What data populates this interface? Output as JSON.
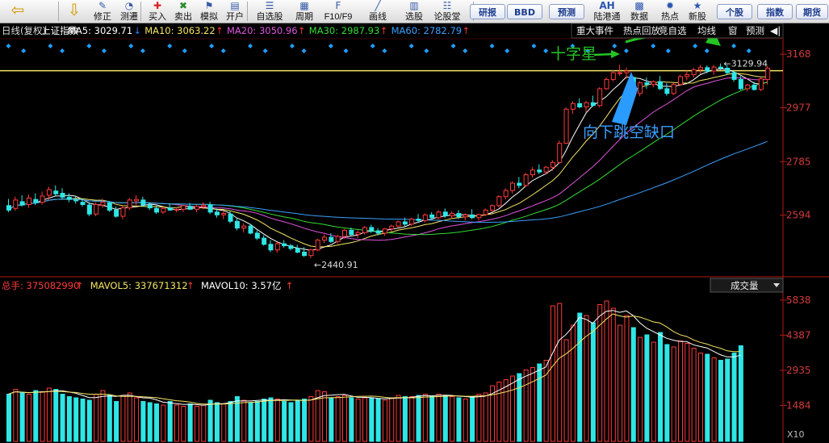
{
  "toolbar": {
    "buttons": [
      {
        "label": "",
        "icon": "left-arrow-icon"
      },
      {
        "label": "",
        "icon": "down-arrow-icon"
      },
      {
        "label": "修正",
        "icon": "edit-icon"
      },
      {
        "label": "测遷",
        "icon": "gauge-icon"
      },
      {
        "label": "买入",
        "icon": "buy-icon"
      },
      {
        "label": "卖出",
        "icon": "sell-icon"
      },
      {
        "label": "模拟",
        "icon": "simulate-icon"
      },
      {
        "label": "开户",
        "icon": "account-icon"
      },
      {
        "label": "自选股",
        "icon": "watchlist-icon"
      },
      {
        "label": "周期",
        "icon": "period-icon"
      },
      {
        "label": "F10/F9",
        "icon": "f10-icon"
      },
      {
        "label": "画线",
        "icon": "draw-line-icon"
      },
      {
        "label": "选股",
        "icon": "stock-picker-icon"
      },
      {
        "label": "论股堂",
        "icon": "forum-icon"
      }
    ],
    "pills": [
      "研报",
      "BBD",
      "预测"
    ],
    "right_buttons": [
      {
        "label": "陆港通",
        "icon": "AH"
      },
      {
        "label": "数据",
        "icon": "data-icon"
      },
      {
        "label": "热点",
        "icon": "hot-icon"
      },
      {
        "label": "新股",
        "icon": "ipo-icon"
      }
    ],
    "tabs": [
      "个股",
      "指数",
      "期货"
    ]
  },
  "kline_header": {
    "period": "日线(复权)",
    "name": "上证指数",
    "ma": [
      {
        "label": "MA5: 3029.71",
        "arrow": "↓",
        "color": "#ffffff",
        "arrow_color": "#2f7cff"
      },
      {
        "label": "MA10: 3063.22",
        "arrow": "↑",
        "color": "#f5e663",
        "arrow_color": "#ff3333"
      },
      {
        "label": "MA20: 3050.96",
        "arrow": "↑",
        "color": "#e055e0",
        "arrow_color": "#ff3333"
      },
      {
        "label": "MA30: 2987.93",
        "arrow": "↑",
        "color": "#33dd33",
        "arrow_color": "#ff3333"
      },
      {
        "label": "MA60: 2782.79",
        "arrow": "↑",
        "color": "#3aa0ff",
        "arrow_color": "#ff3333"
      }
    ],
    "menu": [
      "重大事件",
      "热点回放",
      "竞自选",
      "均线",
      "窗",
      "预测"
    ]
  },
  "vol_header": {
    "total": "总手: 375082990",
    "total_arrow": "↑",
    "mavol5": "MAVOL5: 337671312",
    "mavol5_arrow": "↑",
    "mavol10": "MAVOL10: 3.57亿",
    "mavol10_arrow": "↑",
    "selector": "成交量"
  },
  "annotations": {
    "doji": "十字星",
    "gap": "向下跳空缺口",
    "high_label": "3129.94",
    "low_label": "2440.91"
  },
  "chart_data": {
    "type": "candlestick",
    "title": "上证指数",
    "price_axis": {
      "ticks": [
        3168,
        2977,
        2785,
        2594
      ],
      "range": [
        2380,
        3180
      ]
    },
    "volume_axis": {
      "ticks": [
        5838,
        4387,
        2935,
        1484
      ],
      "unit_label": "X10",
      "range": [
        0,
        6100
      ]
    },
    "reference_line": 3109,
    "candles": [
      {
        "o": 2628,
        "h": 2652,
        "l": 2605,
        "c": 2612
      },
      {
        "o": 2618,
        "h": 2660,
        "l": 2610,
        "c": 2648
      },
      {
        "o": 2642,
        "h": 2665,
        "l": 2625,
        "c": 2630
      },
      {
        "o": 2632,
        "h": 2668,
        "l": 2620,
        "c": 2655
      },
      {
        "o": 2650,
        "h": 2672,
        "l": 2630,
        "c": 2640
      },
      {
        "o": 2640,
        "h": 2678,
        "l": 2632,
        "c": 2662
      },
      {
        "o": 2665,
        "h": 2695,
        "l": 2650,
        "c": 2685
      },
      {
        "o": 2680,
        "h": 2700,
        "l": 2660,
        "c": 2670
      },
      {
        "o": 2672,
        "h": 2690,
        "l": 2650,
        "c": 2658
      },
      {
        "o": 2658,
        "h": 2672,
        "l": 2640,
        "c": 2650
      },
      {
        "o": 2648,
        "h": 2660,
        "l": 2635,
        "c": 2645
      },
      {
        "o": 2640,
        "h": 2652,
        "l": 2625,
        "c": 2632
      },
      {
        "o": 2630,
        "h": 2640,
        "l": 2590,
        "c": 2598
      },
      {
        "o": 2598,
        "h": 2640,
        "l": 2590,
        "c": 2632
      },
      {
        "o": 2630,
        "h": 2652,
        "l": 2620,
        "c": 2640
      },
      {
        "o": 2638,
        "h": 2645,
        "l": 2605,
        "c": 2612
      },
      {
        "o": 2612,
        "h": 2625,
        "l": 2585,
        "c": 2590
      },
      {
        "o": 2590,
        "h": 2628,
        "l": 2580,
        "c": 2620
      },
      {
        "o": 2620,
        "h": 2655,
        "l": 2612,
        "c": 2648
      },
      {
        "o": 2645,
        "h": 2665,
        "l": 2630,
        "c": 2650
      },
      {
        "o": 2648,
        "h": 2660,
        "l": 2625,
        "c": 2630
      },
      {
        "o": 2630,
        "h": 2640,
        "l": 2612,
        "c": 2620
      },
      {
        "o": 2618,
        "h": 2628,
        "l": 2598,
        "c": 2605
      },
      {
        "o": 2605,
        "h": 2625,
        "l": 2598,
        "c": 2618
      },
      {
        "o": 2620,
        "h": 2635,
        "l": 2610,
        "c": 2612
      },
      {
        "o": 2612,
        "h": 2622,
        "l": 2605,
        "c": 2615
      },
      {
        "o": 2615,
        "h": 2630,
        "l": 2605,
        "c": 2628
      },
      {
        "o": 2625,
        "h": 2638,
        "l": 2612,
        "c": 2615
      },
      {
        "o": 2615,
        "h": 2632,
        "l": 2605,
        "c": 2625
      },
      {
        "o": 2625,
        "h": 2640,
        "l": 2615,
        "c": 2630
      },
      {
        "o": 2630,
        "h": 2642,
        "l": 2598,
        "c": 2605
      },
      {
        "o": 2605,
        "h": 2618,
        "l": 2585,
        "c": 2595
      },
      {
        "o": 2595,
        "h": 2608,
        "l": 2580,
        "c": 2600
      },
      {
        "o": 2598,
        "h": 2608,
        "l": 2565,
        "c": 2572
      },
      {
        "o": 2572,
        "h": 2582,
        "l": 2540,
        "c": 2548
      },
      {
        "o": 2548,
        "h": 2565,
        "l": 2532,
        "c": 2555
      },
      {
        "o": 2555,
        "h": 2562,
        "l": 2525,
        "c": 2530
      },
      {
        "o": 2530,
        "h": 2540,
        "l": 2505,
        "c": 2512
      },
      {
        "o": 2512,
        "h": 2522,
        "l": 2485,
        "c": 2490
      },
      {
        "o": 2490,
        "h": 2505,
        "l": 2462,
        "c": 2470
      },
      {
        "o": 2470,
        "h": 2498,
        "l": 2460,
        "c": 2492
      },
      {
        "o": 2492,
        "h": 2505,
        "l": 2478,
        "c": 2485
      },
      {
        "o": 2485,
        "h": 2492,
        "l": 2468,
        "c": 2475
      },
      {
        "o": 2475,
        "h": 2488,
        "l": 2458,
        "c": 2462
      },
      {
        "o": 2462,
        "h": 2480,
        "l": 2445,
        "c": 2450
      },
      {
        "o": 2450,
        "h": 2475,
        "l": 2441,
        "c": 2470
      },
      {
        "o": 2470,
        "h": 2510,
        "l": 2465,
        "c": 2505
      },
      {
        "o": 2505,
        "h": 2525,
        "l": 2495,
        "c": 2515
      },
      {
        "o": 2515,
        "h": 2530,
        "l": 2495,
        "c": 2500
      },
      {
        "o": 2500,
        "h": 2525,
        "l": 2492,
        "c": 2518
      },
      {
        "o": 2518,
        "h": 2545,
        "l": 2510,
        "c": 2540
      },
      {
        "o": 2540,
        "h": 2550,
        "l": 2520,
        "c": 2525
      },
      {
        "o": 2525,
        "h": 2540,
        "l": 2512,
        "c": 2532
      },
      {
        "o": 2532,
        "h": 2555,
        "l": 2525,
        "c": 2550
      },
      {
        "o": 2550,
        "h": 2560,
        "l": 2530,
        "c": 2538
      },
      {
        "o": 2538,
        "h": 2548,
        "l": 2522,
        "c": 2530
      },
      {
        "o": 2530,
        "h": 2548,
        "l": 2520,
        "c": 2545
      },
      {
        "o": 2545,
        "h": 2560,
        "l": 2535,
        "c": 2555
      },
      {
        "o": 2555,
        "h": 2575,
        "l": 2548,
        "c": 2570
      },
      {
        "o": 2570,
        "h": 2585,
        "l": 2555,
        "c": 2562
      },
      {
        "o": 2562,
        "h": 2585,
        "l": 2555,
        "c": 2580
      },
      {
        "o": 2580,
        "h": 2598,
        "l": 2568,
        "c": 2575
      },
      {
        "o": 2575,
        "h": 2600,
        "l": 2568,
        "c": 2595
      },
      {
        "o": 2595,
        "h": 2605,
        "l": 2578,
        "c": 2585
      },
      {
        "o": 2585,
        "h": 2612,
        "l": 2578,
        "c": 2605
      },
      {
        "o": 2605,
        "h": 2618,
        "l": 2585,
        "c": 2592
      },
      {
        "o": 2592,
        "h": 2608,
        "l": 2580,
        "c": 2600
      },
      {
        "o": 2600,
        "h": 2612,
        "l": 2580,
        "c": 2588
      },
      {
        "o": 2588,
        "h": 2600,
        "l": 2575,
        "c": 2595
      },
      {
        "o": 2595,
        "h": 2615,
        "l": 2580,
        "c": 2585
      },
      {
        "o": 2585,
        "h": 2600,
        "l": 2575,
        "c": 2596
      },
      {
        "o": 2596,
        "h": 2618,
        "l": 2590,
        "c": 2612
      },
      {
        "o": 2612,
        "h": 2632,
        "l": 2605,
        "c": 2628
      },
      {
        "o": 2628,
        "h": 2665,
        "l": 2622,
        "c": 2660
      },
      {
        "o": 2660,
        "h": 2690,
        "l": 2650,
        "c": 2682
      },
      {
        "o": 2682,
        "h": 2715,
        "l": 2672,
        "c": 2708
      },
      {
        "o": 2708,
        "h": 2730,
        "l": 2690,
        "c": 2700
      },
      {
        "o": 2700,
        "h": 2745,
        "l": 2695,
        "c": 2738
      },
      {
        "o": 2738,
        "h": 2765,
        "l": 2728,
        "c": 2755
      },
      {
        "o": 2755,
        "h": 2775,
        "l": 2740,
        "c": 2748
      },
      {
        "o": 2748,
        "h": 2770,
        "l": 2740,
        "c": 2765
      },
      {
        "o": 2765,
        "h": 2790,
        "l": 2752,
        "c": 2782
      },
      {
        "o": 2782,
        "h": 2860,
        "l": 2778,
        "c": 2850
      },
      {
        "o": 2850,
        "h": 2978,
        "l": 2848,
        "c": 2972
      },
      {
        "o": 2972,
        "h": 3000,
        "l": 2955,
        "c": 2992
      },
      {
        "o": 2992,
        "h": 3010,
        "l": 2975,
        "c": 2980
      },
      {
        "o": 2980,
        "h": 3002,
        "l": 2960,
        "c": 2995
      },
      {
        "o": 2995,
        "h": 3020,
        "l": 2980,
        "c": 2985
      },
      {
        "o": 2985,
        "h": 3050,
        "l": 2978,
        "c": 3045
      },
      {
        "o": 3045,
        "h": 3085,
        "l": 3040,
        "c": 3078
      },
      {
        "o": 3078,
        "h": 3110,
        "l": 3070,
        "c": 3102
      },
      {
        "o": 3100,
        "h": 3130,
        "l": 3090,
        "c": 3102
      },
      {
        "o": 3102,
        "h": 3120,
        "l": 3080,
        "c": 3108
      },
      {
        "o": 3085,
        "h": 3090,
        "l": 3018,
        "c": 3028
      },
      {
        "o": 3028,
        "h": 3072,
        "l": 3018,
        "c": 3066
      },
      {
        "o": 3066,
        "h": 3085,
        "l": 3045,
        "c": 3060
      },
      {
        "o": 3060,
        "h": 3075,
        "l": 3050,
        "c": 3070
      },
      {
        "o": 3070,
        "h": 3090,
        "l": 3040,
        "c": 3045
      },
      {
        "o": 3045,
        "h": 3065,
        "l": 3020,
        "c": 3028
      },
      {
        "o": 3028,
        "h": 3065,
        "l": 3022,
        "c": 3060
      },
      {
        "o": 3060,
        "h": 3095,
        "l": 3055,
        "c": 3088
      },
      {
        "o": 3088,
        "h": 3110,
        "l": 3075,
        "c": 3095
      },
      {
        "o": 3095,
        "h": 3120,
        "l": 3085,
        "c": 3112
      },
      {
        "o": 3112,
        "h": 3130,
        "l": 3098,
        "c": 3120
      },
      {
        "o": 3120,
        "h": 3128,
        "l": 3100,
        "c": 3108
      },
      {
        "o": 3108,
        "h": 3130,
        "l": 3095,
        "c": 3122
      },
      {
        "o": 3122,
        "h": 3135,
        "l": 3110,
        "c": 3118
      },
      {
        "o": 3118,
        "h": 3130,
        "l": 3095,
        "c": 3102
      },
      {
        "o": 3102,
        "h": 3112,
        "l": 3070,
        "c": 3078
      },
      {
        "o": 3078,
        "h": 3090,
        "l": 3040,
        "c": 3045
      },
      {
        "o": 3045,
        "h": 3062,
        "l": 3035,
        "c": 3058
      },
      {
        "o": 3058,
        "h": 3070,
        "l": 3038,
        "c": 3042
      },
      {
        "o": 3042,
        "h": 3085,
        "l": 3036,
        "c": 3080
      },
      {
        "o": 3078,
        "h": 3125,
        "l": 3060,
        "c": 3118
      }
    ],
    "volumes": [
      1950,
      2150,
      2000,
      1950,
      2100,
      2050,
      2200,
      2150,
      1950,
      1850,
      1800,
      1750,
      1700,
      1950,
      2100,
      1900,
      1650,
      1900,
      2000,
      1800,
      1650,
      1600,
      1550,
      1500,
      1650,
      1500,
      1450,
      1550,
      1450,
      1500,
      1700,
      1600,
      1550,
      1650,
      1850,
      1700,
      1600,
      1650,
      1750,
      1800,
      1750,
      1650,
      1600,
      1700,
      1750,
      1850,
      2100,
      2050,
      1800,
      1850,
      1900,
      1800,
      1750,
      1800,
      1800,
      1750,
      1700,
      1800,
      1900,
      1850,
      1850,
      1900,
      1950,
      1850,
      1950,
      1900,
      1850,
      1800,
      1750,
      1850,
      1950,
      2000,
      2300,
      2450,
      2550,
      2700,
      2800,
      2950,
      3050,
      3200,
      3350,
      5600,
      5700,
      4200,
      4800,
      5300,
      5200,
      4900,
      5650,
      5800,
      5500,
      4800,
      5200,
      4700,
      4300,
      4400,
      4100,
      4500,
      4000,
      3900,
      4150,
      4050,
      3850,
      3650,
      3600,
      3450,
      3350,
      3400,
      3650,
      3950
    ],
    "ma_series": [
      {
        "name": "MA5",
        "color": "#ffffff"
      },
      {
        "name": "MA10",
        "color": "#f5e663"
      },
      {
        "name": "MA20",
        "color": "#e055e0"
      },
      {
        "name": "MA30",
        "color": "#33dd33"
      },
      {
        "name": "MA60",
        "color": "#3aa0ff"
      }
    ],
    "vol_ma_series": [
      {
        "name": "MAVOL5",
        "color": "#ffffff"
      },
      {
        "name": "MAVOL10",
        "color": "#f5e663"
      }
    ],
    "colors": {
      "up": "#ff3a3a",
      "down": "#2fe6e6",
      "ref_line": "#f5e663",
      "axis": "#b01818",
      "diamond": "#1e9fff"
    }
  }
}
